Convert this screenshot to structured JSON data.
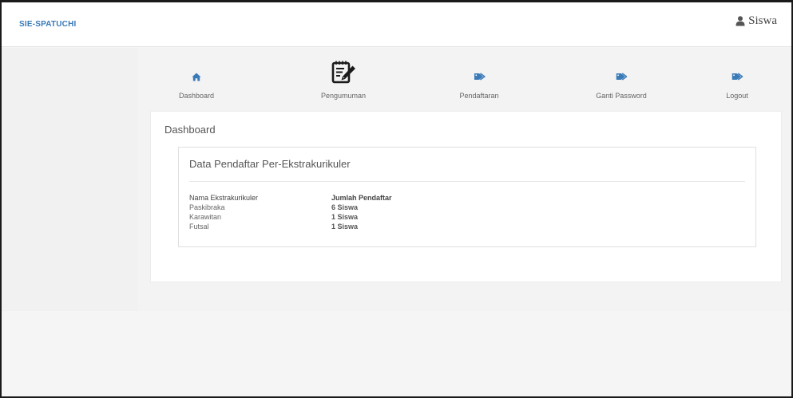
{
  "navbar": {
    "brand": "SIE-SPATUCHI",
    "user_icon": "user-icon",
    "user_label": "Siswa"
  },
  "menu": {
    "items": [
      {
        "label": "Dashboard",
        "icon": "home-icon"
      },
      {
        "label": "Pengumuman",
        "icon": "notepad-edit-icon"
      },
      {
        "label": "Pendaftaran",
        "icon": "tag-icon"
      },
      {
        "label": "Ganti Password",
        "icon": "tag-icon"
      },
      {
        "label": "Logout",
        "icon": "tag-icon"
      }
    ]
  },
  "panel": {
    "title": "Dashboard",
    "card": {
      "title": "Data Pendaftar Per-Ekstrakurikuler",
      "columns": [
        "Nama Ekstrakurikuler",
        "Jumlah Pendaftar"
      ],
      "rows": [
        {
          "name": "Paskibraka",
          "count": "6 Siswa"
        },
        {
          "name": "Karawitan",
          "count": "1 Siswa"
        },
        {
          "name": "Futsal",
          "count": "1 Siswa"
        }
      ]
    }
  },
  "colors": {
    "brand": "#3a7ab8",
    "icon": "#3a7ab8",
    "background": "#f5f5f5",
    "panel": "#ffffff"
  }
}
